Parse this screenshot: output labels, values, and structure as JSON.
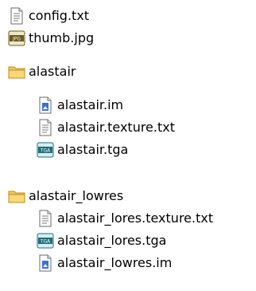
{
  "tree": {
    "root_files": [
      {
        "label": "config.txt",
        "icon": "text-file-icon"
      },
      {
        "label": "thumb.jpg",
        "icon": "jpg-file-icon"
      }
    ],
    "folders": [
      {
        "label": "alastair",
        "icon": "folder-icon",
        "children": [
          {
            "label": "alastair.im",
            "icon": "image-file-icon"
          },
          {
            "label": "alastair.texture.txt",
            "icon": "text-file-icon"
          },
          {
            "label": "alastair.tga",
            "icon": "tga-file-icon"
          }
        ]
      },
      {
        "label": "alastair_lowres",
        "icon": "folder-icon",
        "children": [
          {
            "label": "alastair_lores.texture.txt",
            "icon": "text-file-icon"
          },
          {
            "label": "alastair_lores.tga",
            "icon": "tga-file-icon"
          },
          {
            "label": "alastair_lowres.im",
            "icon": "image-file-icon"
          }
        ]
      }
    ]
  },
  "colors": {
    "folder": "#f2c75c",
    "tga_badge": "#1f6f7a",
    "jpg_badge": "#6b5a1f",
    "im_badge": "#3b6fd6"
  }
}
